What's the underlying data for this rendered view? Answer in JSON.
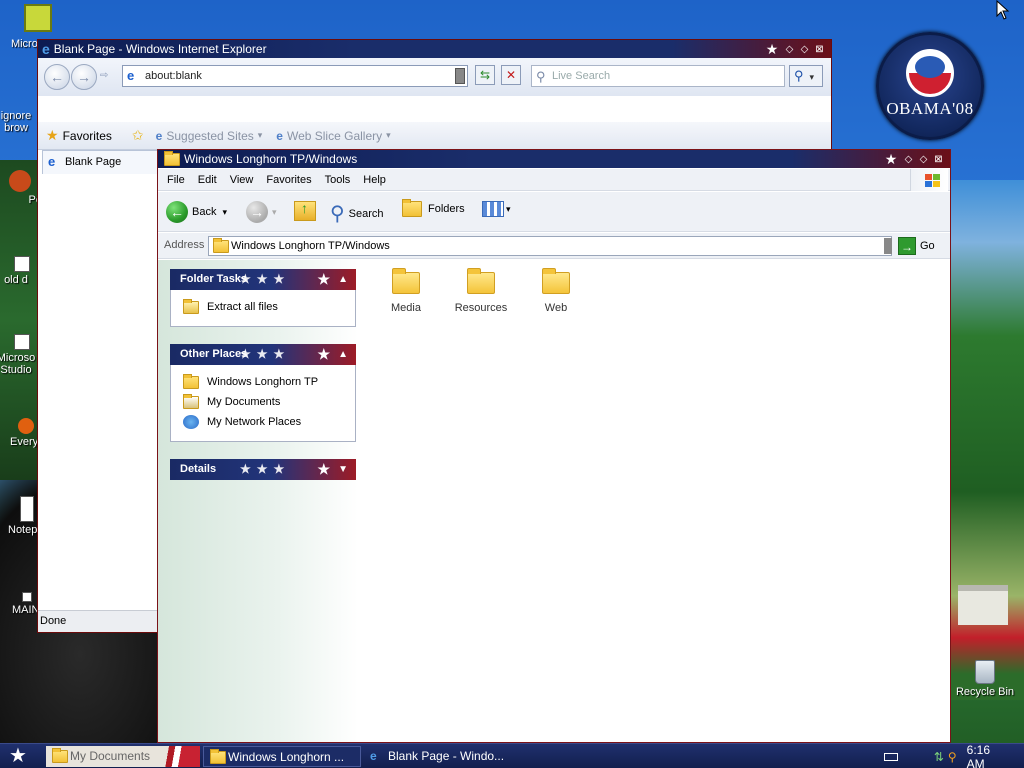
{
  "desktop": {
    "icons": [
      {
        "label": "Micro Outl",
        "icon": "outlook-icon"
      },
      {
        "label": "ignore brow",
        "icon": "shortcut-icon"
      },
      {
        "label": "Pe",
        "icon": "shortcut-icon"
      },
      {
        "label": "old d",
        "icon": "shortcut-icon"
      },
      {
        "label": "Microso Studio",
        "icon": "shortcut-icon"
      },
      {
        "label": "Every",
        "icon": "shortcut-icon"
      },
      {
        "label": "Notep",
        "icon": "notepad-icon"
      },
      {
        "label": "MAIN",
        "icon": "shortcut-icon"
      }
    ],
    "recycle_bin_label": "Recycle Bin",
    "badge_text": "OBAMA'08"
  },
  "ie": {
    "title": "Blank Page - Windows Internet Explorer",
    "address": "about:blank",
    "search_placeholder": "Live Search",
    "favorites_label": "Favorites",
    "suggested_sites": "Suggested Sites",
    "web_slice_gallery": "Web Slice Gallery",
    "tab_label": "Blank Page",
    "status": "Done"
  },
  "explorer": {
    "title": "Windows Longhorn TP/Windows",
    "menu": [
      "File",
      "Edit",
      "View",
      "Favorites",
      "Tools",
      "Help"
    ],
    "toolbar": {
      "back": "Back",
      "search": "Search",
      "folders": "Folders"
    },
    "address_label": "Address",
    "address_value": "Windows Longhorn TP/Windows",
    "go_label": "Go",
    "panels": {
      "folder_tasks": {
        "title": "Folder Tasks",
        "items": [
          "Extract all files"
        ]
      },
      "other_places": {
        "title": "Other Places",
        "items": [
          "Windows Longhorn TP",
          "My Documents",
          "My Network Places"
        ]
      },
      "details": {
        "title": "Details"
      }
    },
    "folders": [
      "Media",
      "Resources",
      "Web"
    ]
  },
  "taskbar": {
    "items": [
      "My Documents",
      "Windows Longhorn ...",
      "Blank Page - Windo..."
    ],
    "clock": "6:16 AM"
  },
  "colors": {
    "title_blue": "#1a2d6a",
    "title_red": "#6b0f18",
    "accent_red": "#9d1b26"
  }
}
